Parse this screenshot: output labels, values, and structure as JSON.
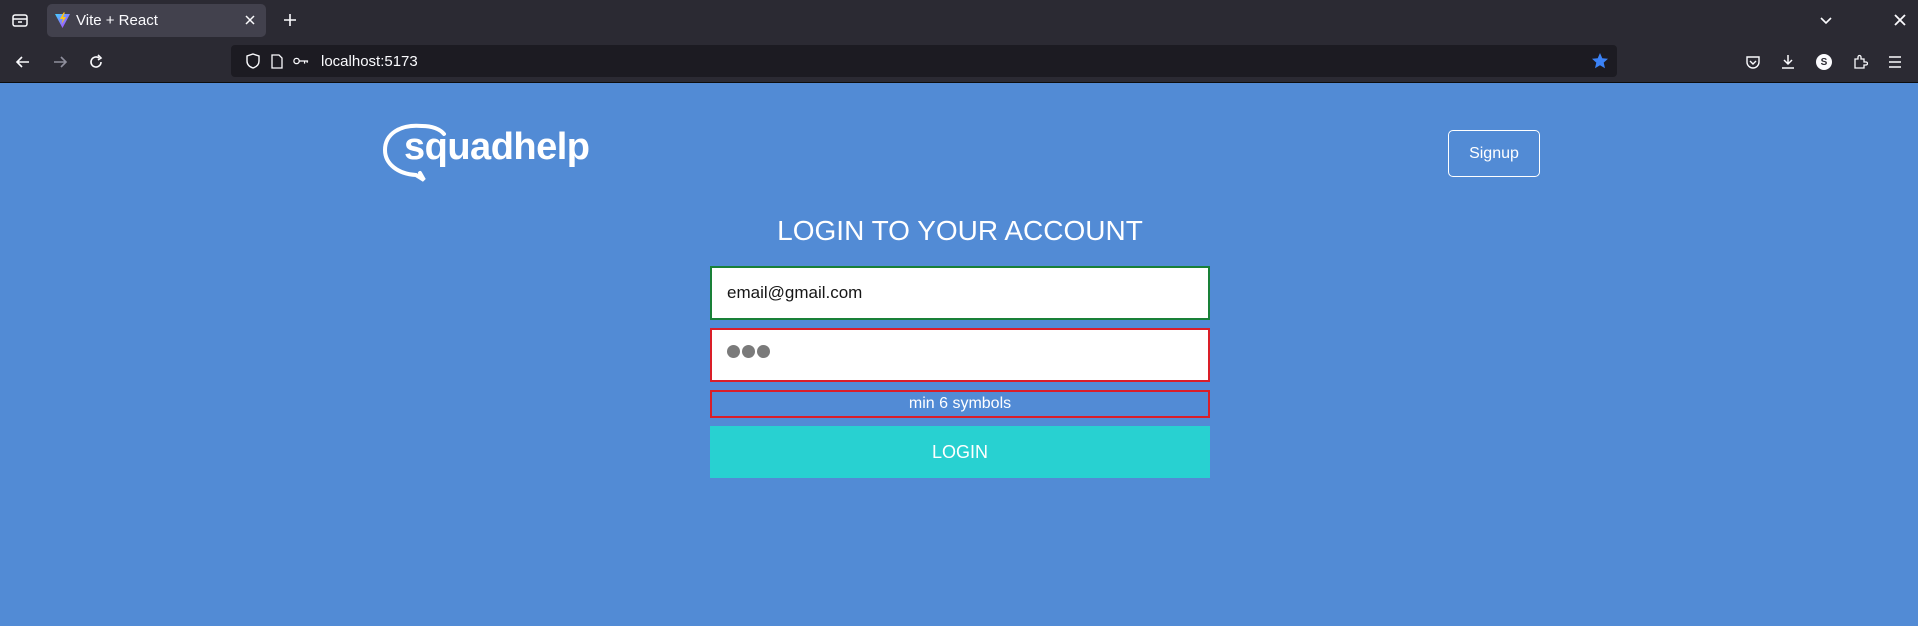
{
  "browser": {
    "tab": {
      "title": "Vite + React"
    },
    "url": "localhost:5173",
    "profile_initial": "S"
  },
  "header": {
    "logo_text": "squadhelp",
    "signup_label": "Signup"
  },
  "login_form": {
    "title": "LOGIN TO YOUR ACCOUNT",
    "email_value": "email@gmail.com",
    "password_masked_length": 3,
    "error_message": "min 6 symbols",
    "submit_label": "LOGIN"
  },
  "colors": {
    "page_background": "#528bd5",
    "valid_border": "#198038",
    "invalid_border": "#da1e28",
    "login_button": "#28d1d1",
    "chrome_dark": "#2b2a33",
    "bookmark_star": "#3b82f6"
  },
  "icons": [
    "tab-list-icon",
    "vite-favicon-icon",
    "close-icon",
    "plus-icon",
    "chevron-down-icon",
    "back-arrow-icon",
    "forward-arrow-icon",
    "reload-icon",
    "shield-icon",
    "page-icon",
    "key-icon",
    "star-icon",
    "pocket-icon",
    "download-icon",
    "extensions-icon",
    "menu-icon",
    "speech-bubble-icon"
  ]
}
